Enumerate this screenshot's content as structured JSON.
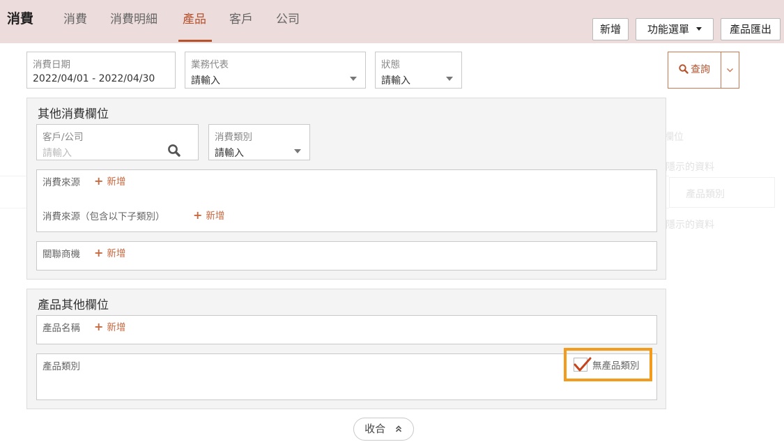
{
  "header": {
    "app_title": "消費",
    "tabs": [
      "消費",
      "消費明細",
      "產品",
      "客戶",
      "公司"
    ],
    "active_tab": "產品",
    "buttons": {
      "add": "新增",
      "menu": "功能選單",
      "export": "產品匯出"
    }
  },
  "filters": {
    "date": {
      "label": "消費日期",
      "value": "2022/04/01 - 2022/04/30"
    },
    "rep": {
      "label": "業務代表",
      "value": "請輸入"
    },
    "status": {
      "label": "狀態",
      "value": "請輸入"
    },
    "query_button": "查詢"
  },
  "other_fields": {
    "title": "其他消費欄位",
    "customer": {
      "label": "客戶/公司",
      "placeholder": "請輸入"
    },
    "category": {
      "label": "消費類別",
      "value": "請輸入"
    },
    "source_label": "消費來源",
    "source_sub_label": "消費來源（包含以下子類別）",
    "opportunity_label": "關聯商機",
    "add_label": "新增"
  },
  "product_fields": {
    "title": "產品其他欄位",
    "product_name_label": "產品名稱",
    "product_category_label": "產品類別",
    "no_category_label": "無產品類別",
    "no_category_checked": true,
    "add_label": "新增"
  },
  "collapse_button": "收合",
  "background": {
    "column_setting": "欄位",
    "hidden_data_1": "隱示的資料",
    "product_category_header": "產品類別",
    "hidden_data_2": "隱示的資料"
  },
  "colors": {
    "accent": "#b5532f",
    "add_link": "#c9683f",
    "highlight": "#f39b1c",
    "header_bg": "#ecdcdc"
  },
  "icons": {
    "search": "search-icon",
    "dropdown": "caret-down-icon",
    "chevron": "chevron-down-icon",
    "plus": "plus-icon",
    "collapse": "double-chevron-up-icon",
    "check": "check-icon"
  }
}
